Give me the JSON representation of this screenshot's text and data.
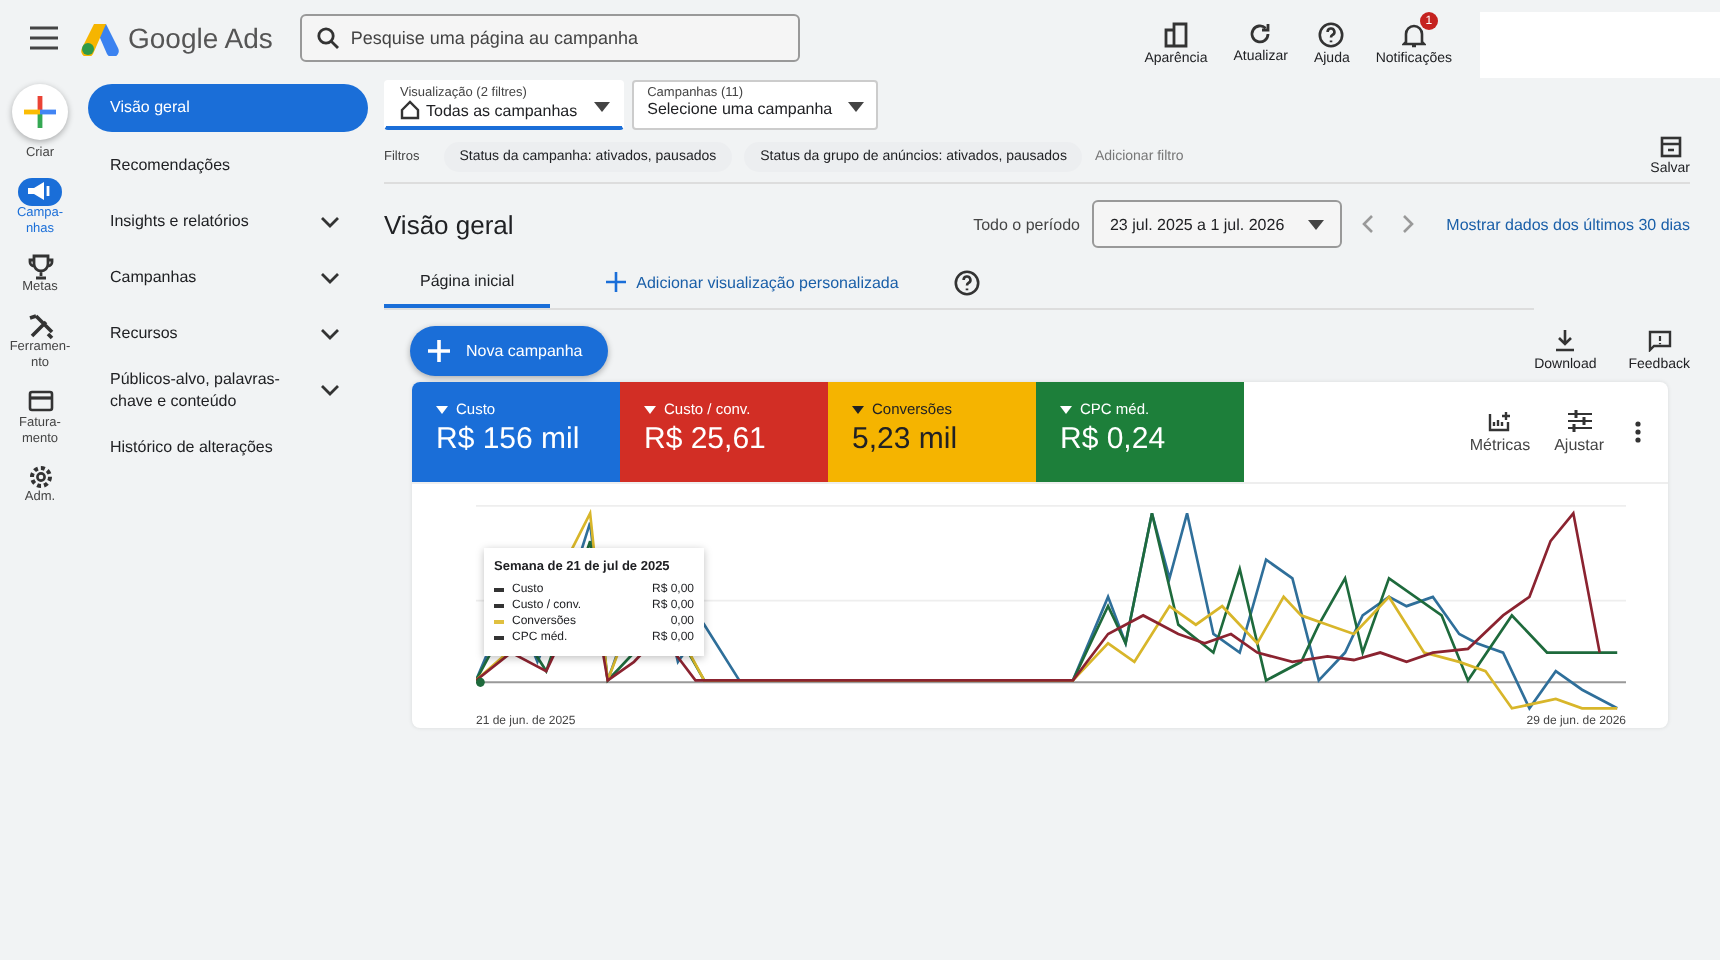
{
  "header": {
    "product": "Google Ads",
    "search": {
      "placeholder": "Pesquise uma página au campanha"
    },
    "actions": [
      {
        "kind": "appearance",
        "label": "Aparência"
      },
      {
        "kind": "refresh",
        "label": "Atualizar"
      },
      {
        "kind": "help",
        "label": "Ajuda"
      },
      {
        "kind": "notifications",
        "label": "Notificações",
        "badge": "1"
      }
    ]
  },
  "rail": [
    {
      "kind": "create",
      "label": "Criar",
      "selected": false
    },
    {
      "kind": "campaigns",
      "label": "Campa-\nnhas",
      "selected": true
    },
    {
      "kind": "goals",
      "label": "Metas",
      "selected": false
    },
    {
      "kind": "tools",
      "label": "Ferramen-\nnto",
      "selected": false
    },
    {
      "kind": "billing",
      "label": "Fatura-\nmento",
      "selected": false
    },
    {
      "kind": "admin",
      "label": "Adm.",
      "selected": false
    }
  ],
  "nav": [
    {
      "label": "Visão geral",
      "selected": true,
      "expandable": false
    },
    {
      "label": "Recomendações",
      "selected": false,
      "expandable": false
    },
    {
      "label": "Insights e relatórios",
      "selected": false,
      "expandable": true
    },
    {
      "label": "Campanhas",
      "selected": false,
      "expandable": true
    },
    {
      "label": "Recursos",
      "selected": false,
      "expandable": true
    },
    {
      "label": "Públicos-alvo, palavras-chave e conteúdo",
      "selected": false,
      "expandable": true
    },
    {
      "label": "Histórico de alterações",
      "selected": false,
      "expandable": false
    }
  ],
  "selectors": [
    {
      "caption": "Visualização (2 filtres)",
      "value": "Todas as campanhas",
      "home": true
    },
    {
      "caption": "Campanhas (11)",
      "value": "Selecione uma campanha",
      "home": false
    }
  ],
  "filters": {
    "label": "Filtros",
    "chips": [
      "Status da campanha: ativados, pausados",
      "Status da grupo de anúncios: ativados, pausados"
    ],
    "add": "Adicionar filtro",
    "save": "Salvar"
  },
  "page": {
    "title": "Visão geral",
    "period_label": "Todo o período",
    "date_range": "23 jul. 2025 a 1 jul. 2026",
    "show_last": "Mostrar dados dos últimos 30 dias"
  },
  "tabs": [
    {
      "label": "Página inicial",
      "selected": true
    },
    {
      "label": "Adicionar visualização personalizada",
      "selected": false,
      "kind": "add"
    }
  ],
  "new_campaign": "Nova campanha",
  "tools": [
    {
      "kind": "download",
      "label": "Download"
    },
    {
      "kind": "feedback",
      "label": "Feedback"
    }
  ],
  "metrics": [
    {
      "label": "Custo",
      "value": "R$ 156 mil",
      "color": "#1a6ed8"
    },
    {
      "label": "Custo / conv.",
      "value": "R$ 25,61",
      "color": "#d22e25"
    },
    {
      "label": "Conversões",
      "value": "5,23 mil",
      "color": "#f5b400"
    },
    {
      "label": "CPC méd.",
      "value": "R$ 0,24",
      "color": "#1d7f3a"
    }
  ],
  "card_actions": [
    {
      "kind": "metrics",
      "label": "Métricas"
    },
    {
      "kind": "adjust",
      "label": "Ajustar"
    }
  ],
  "chart": {
    "start": "21 de jun. de 2025",
    "end": "29 de jun. de 2026",
    "tooltip": {
      "title": "Semana de 21 de jul de 2025",
      "rows": [
        {
          "name": "Custo",
          "value": "R$ 0,00",
          "color": "#333333"
        },
        {
          "name": "Custo / conv.",
          "value": "R$ 0,00",
          "color": "#333333"
        },
        {
          "name": "Conversões",
          "value": "0,00",
          "color": "#e0c040"
        },
        {
          "name": "CPC méd.",
          "value": "R$ 0,00",
          "color": "#333333"
        }
      ]
    }
  }
}
